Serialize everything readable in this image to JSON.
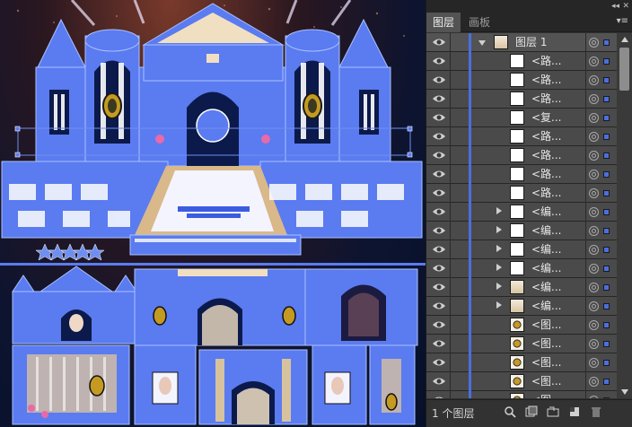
{
  "panel": {
    "tabs": [
      {
        "label": "图层",
        "active": true
      },
      {
        "label": "画板",
        "active": false
      }
    ],
    "footer_count": "1 个图层",
    "accent_color": "#4b6fe0"
  },
  "layers": [
    {
      "label": "图层 1",
      "level": "top",
      "expanded": true,
      "thumb": "tan"
    },
    {
      "label": "<路...",
      "level": "child",
      "thumb": "white"
    },
    {
      "label": "<路...",
      "level": "child",
      "thumb": "white"
    },
    {
      "label": "<路...",
      "level": "child",
      "thumb": "white"
    },
    {
      "label": "<复...",
      "level": "child",
      "thumb": "white"
    },
    {
      "label": "<路...",
      "level": "child",
      "thumb": "white"
    },
    {
      "label": "<路...",
      "level": "child",
      "thumb": "white"
    },
    {
      "label": "<路...",
      "level": "child",
      "thumb": "white"
    },
    {
      "label": "<路...",
      "level": "child",
      "thumb": "white"
    },
    {
      "label": "<编...",
      "level": "child",
      "group": true,
      "thumb": "white"
    },
    {
      "label": "<编...",
      "level": "child",
      "group": true,
      "thumb": "white"
    },
    {
      "label": "<编...",
      "level": "child",
      "group": true,
      "thumb": "white"
    },
    {
      "label": "<编...",
      "level": "child",
      "group": true,
      "thumb": "white"
    },
    {
      "label": "<编...",
      "level": "child",
      "group": true,
      "thumb": "tan"
    },
    {
      "label": "<编...",
      "level": "child",
      "group": true,
      "thumb": "tan"
    },
    {
      "label": "<图...",
      "level": "child",
      "thumb": "oval"
    },
    {
      "label": "<图...",
      "level": "child",
      "thumb": "oval"
    },
    {
      "label": "<图...",
      "level": "child",
      "thumb": "oval"
    },
    {
      "label": "<图...",
      "level": "child",
      "thumb": "oval"
    },
    {
      "label": "<图...",
      "level": "child",
      "thumb": "oval"
    }
  ]
}
